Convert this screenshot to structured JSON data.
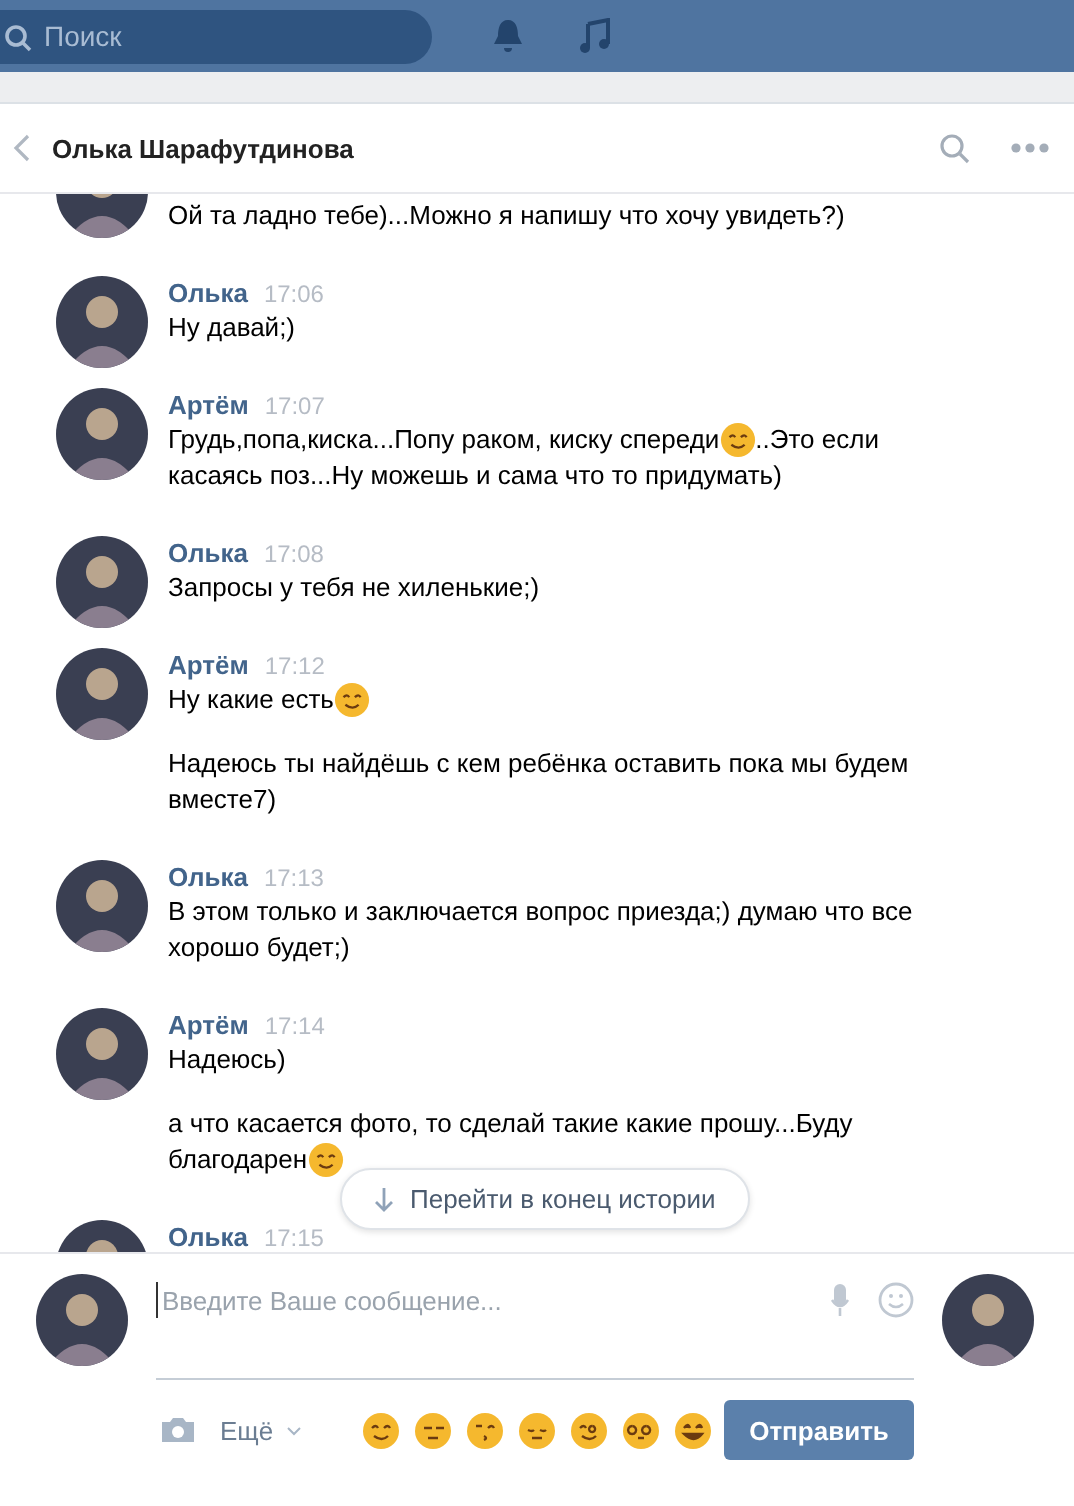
{
  "top_bar": {
    "search": {
      "placeholder": "Поиск"
    }
  },
  "chat_header": {
    "title": "Олька Шарафутдинова"
  },
  "messages": [
    {
      "paragraphs": [
        [
          [
            {
              "kind": "text",
              "text": "Ой та ладно тебе)...Можно я напишу что хочу увидеть?)"
            }
          ]
        ]
      ]
    },
    {
      "author": "Олька",
      "time": "17:06",
      "paragraphs": [
        [
          [
            {
              "kind": "text",
              "text": "Ну давай;)"
            }
          ]
        ]
      ]
    },
    {
      "author": "Артём",
      "time": "17:07",
      "paragraphs": [
        [
          [
            {
              "kind": "text",
              "text": "Грудь,попа,киска...Попу раком, киску спереди"
            },
            {
              "kind": "emoji"
            },
            {
              "kind": "text",
              "text": "..Это если"
            }
          ],
          [
            {
              "kind": "text",
              "text": "касаясь поз...Ну можешь и сама что то придумать)"
            }
          ]
        ]
      ]
    },
    {
      "author": "Олька",
      "time": "17:08",
      "paragraphs": [
        [
          [
            {
              "kind": "text",
              "text": "Запросы у тебя не хиленькие;)"
            }
          ]
        ]
      ]
    },
    {
      "author": "Артём",
      "time": "17:12",
      "paragraphs": [
        [
          [
            {
              "kind": "text",
              "text": "Ну какие есть"
            },
            {
              "kind": "emoji"
            }
          ]
        ],
        [
          [
            {
              "kind": "text",
              "text": "Надеюсь ты найдёшь с кем ребёнка оставить пока мы будем вместе7)"
            }
          ]
        ]
      ]
    },
    {
      "author": "Олька",
      "time": "17:13",
      "paragraphs": [
        [
          [
            {
              "kind": "text",
              "text": "В этом только и заключается вопрос приезда;) думаю что все хорошо будет;)"
            }
          ]
        ]
      ]
    },
    {
      "author": "Артём",
      "time": "17:14",
      "paragraphs": [
        [
          [
            {
              "kind": "text",
              "text": "Надеюсь)"
            }
          ]
        ],
        [
          [
            {
              "kind": "text",
              "text": "а что касается фото, то сделай такие какие прошу...Буду"
            }
          ],
          [
            {
              "kind": "text",
              "text": "благодарен"
            },
            {
              "kind": "emoji"
            }
          ]
        ]
      ]
    },
    {
      "author": "Олька",
      "time": "17:15"
    }
  ],
  "jump_button": {
    "label": "Перейти в конец истории"
  },
  "composer": {
    "placeholder": "Введите Ваше сообщение...",
    "more_label": "Ещё",
    "send_label": "Отправить"
  }
}
